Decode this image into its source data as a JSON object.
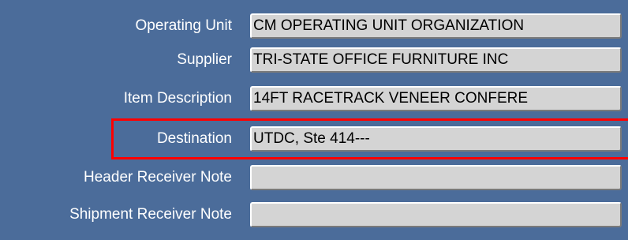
{
  "form": {
    "rows": [
      {
        "label": "Operating Unit",
        "value": "CM OPERATING UNIT ORGANIZATION"
      },
      {
        "label": "Supplier",
        "value": "TRI-STATE OFFICE FURNITURE INC"
      },
      {
        "label": "Item Description",
        "value": "14FT RACETRACK VENEER CONFERE"
      },
      {
        "label": "Destination",
        "value": "UTDC, Ste 414---"
      },
      {
        "label": "Header Receiver Note",
        "value": ""
      },
      {
        "label": "Shipment Receiver Note",
        "value": ""
      }
    ]
  },
  "colors": {
    "background": "#4b6c9a",
    "field_background": "#d4d4d4",
    "label_text": "#ffffff",
    "highlight_border": "#ff0000"
  }
}
